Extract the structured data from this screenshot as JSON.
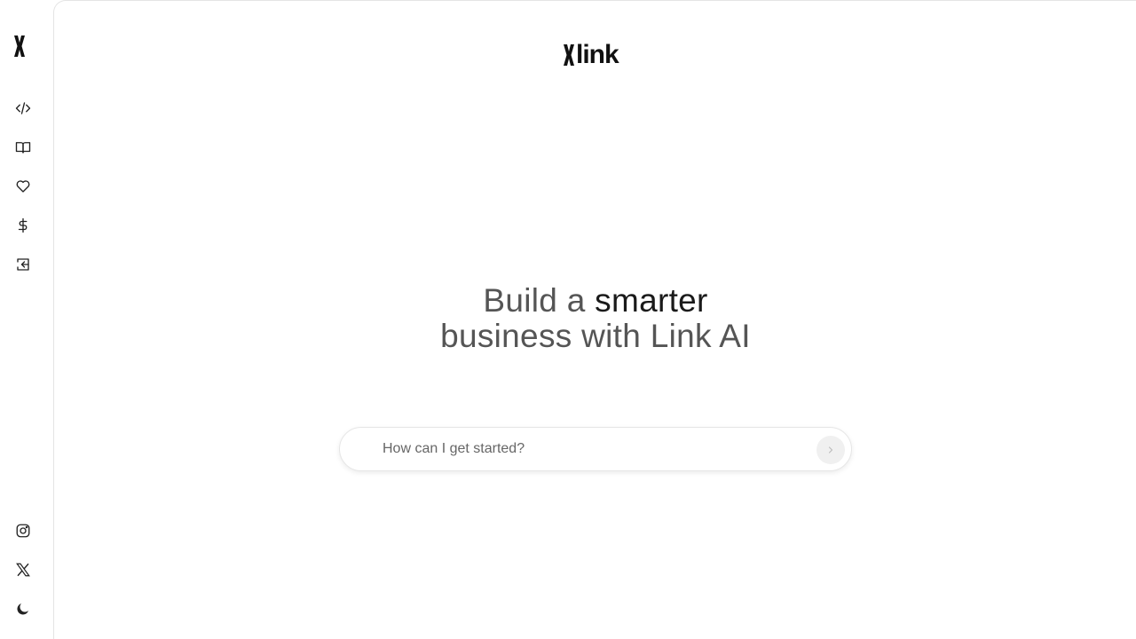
{
  "brand": {
    "logo_icon": "x-mark-logo",
    "name": "link"
  },
  "sidebar": {
    "logo_icon": "x-mark-logo",
    "items": [
      {
        "icon": "code-icon"
      },
      {
        "icon": "book-icon"
      },
      {
        "icon": "heart-icon"
      },
      {
        "icon": "dollar-icon"
      },
      {
        "icon": "sign-in-icon"
      }
    ],
    "bottom": [
      {
        "icon": "instagram-icon"
      },
      {
        "icon": "x-twitter-icon"
      },
      {
        "icon": "moon-icon"
      }
    ]
  },
  "hero": {
    "line1_pre": "Build a ",
    "line1_accent": "smarter",
    "line2": "business with Link AI"
  },
  "search": {
    "placeholder": "How can I get started?",
    "value": "",
    "send_icon": "chevron-right-icon"
  },
  "colors": {
    "text_dark": "#1a1a1a",
    "text_muted": "#555555",
    "border": "#e4e4e4",
    "send_bg": "#f0f0f0"
  }
}
